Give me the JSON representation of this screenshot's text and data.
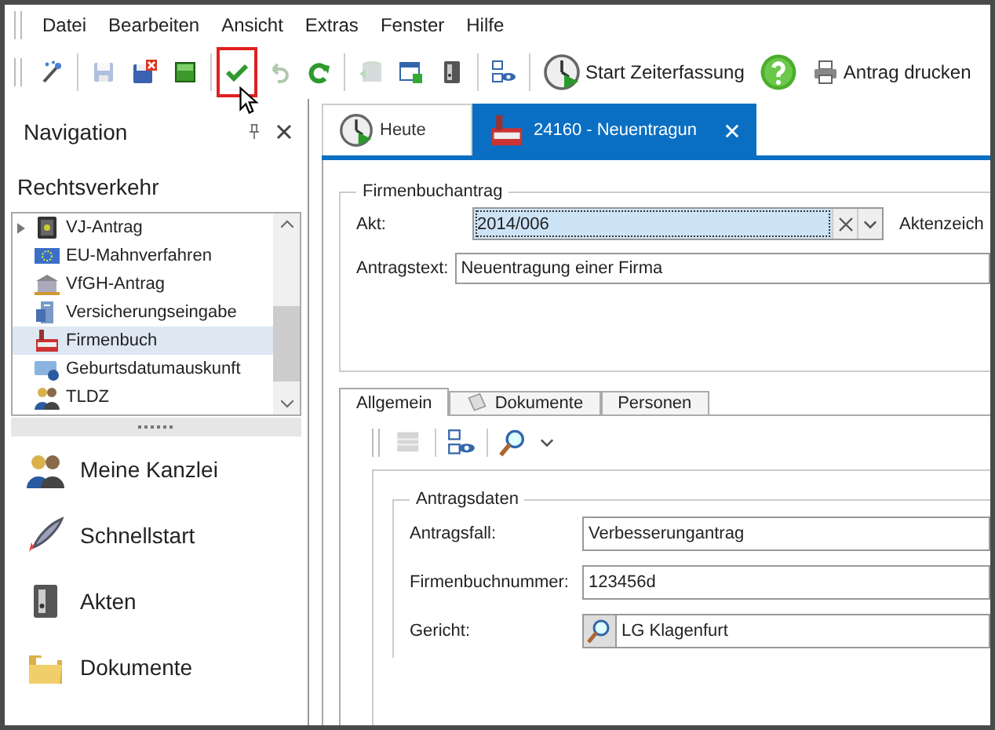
{
  "menu": [
    "Datei",
    "Bearbeiten",
    "Ansicht",
    "Extras",
    "Fenster",
    "Hilfe"
  ],
  "toolbar": [
    {
      "kind": "wand",
      "disabled": false,
      "highlighted": false
    },
    {
      "kind": "separator"
    },
    {
      "kind": "save",
      "disabled": true,
      "highlighted": false
    },
    {
      "kind": "save-close",
      "disabled": false,
      "highlighted": false
    },
    {
      "kind": "square",
      "disabled": false,
      "highlighted": false
    },
    {
      "kind": "separator"
    },
    {
      "kind": "check",
      "disabled": false,
      "highlighted": true
    },
    {
      "kind": "undo",
      "disabled": true,
      "highlighted": false
    },
    {
      "kind": "redo",
      "disabled": false,
      "highlighted": false
    },
    {
      "kind": "separator"
    },
    {
      "kind": "database",
      "disabled": true,
      "highlighted": false
    },
    {
      "kind": "form",
      "disabled": false,
      "highlighted": false
    },
    {
      "kind": "binder",
      "disabled": false,
      "highlighted": false
    },
    {
      "kind": "separator"
    },
    {
      "kind": "network",
      "disabled": false,
      "highlighted": false
    },
    {
      "kind": "separator"
    },
    {
      "kind": "clock",
      "label": "Start Zeiterfassung",
      "disabled": false,
      "highlighted": false
    },
    {
      "kind": "help",
      "disabled": false,
      "highlighted": false
    },
    {
      "kind": "printer",
      "label": "Antrag drucken",
      "disabled": false,
      "highlighted": false
    }
  ],
  "navigation": {
    "title": "Navigation",
    "section": "Rechtsverkehr",
    "items": [
      {
        "label": "VJ-Antrag",
        "expandable": true,
        "selected": false
      },
      {
        "label": "EU-Mahnverfahren",
        "expandable": false,
        "selected": false
      },
      {
        "label": "VfGH-Antrag",
        "expandable": false,
        "selected": false
      },
      {
        "label": "Versicherungseingabe",
        "expandable": false,
        "selected": false
      },
      {
        "label": "Firmenbuch",
        "expandable": false,
        "selected": true
      },
      {
        "label": "Geburtsdatumauskunft",
        "expandable": false,
        "selected": false
      },
      {
        "label": "TLDZ",
        "expandable": false,
        "selected": false
      }
    ],
    "buttons": [
      {
        "label": "Meine Kanzlei"
      },
      {
        "label": "Schnellstart"
      },
      {
        "label": "Akten"
      },
      {
        "label": "Dokumente"
      }
    ]
  },
  "document_tabs": [
    {
      "label": "Heute",
      "selected": false,
      "closable": false
    },
    {
      "label": "24160 - Neuentragun",
      "selected": true,
      "closable": true
    }
  ],
  "firmenbuchantrag": {
    "title": "Firmenbuchantrag",
    "akt_label": "Akt:",
    "akt_value": "2014/006",
    "akt_focused": true,
    "aktenzeichen_label": "Aktenzeich",
    "antragstext_label": "Antragstext:",
    "antragstext_value": "Neuentragung einer Firma"
  },
  "detail_tabs": [
    {
      "label": "Allgemein",
      "selected": true
    },
    {
      "label": "Dokumente",
      "selected": false
    },
    {
      "label": "Personen",
      "selected": false
    }
  ],
  "detail_toolbar": [
    {
      "kind": "grid",
      "disabled": true
    },
    {
      "kind": "network",
      "disabled": false
    },
    {
      "kind": "search",
      "disabled": false,
      "dropdown": true
    }
  ],
  "antragsdaten": {
    "title": "Antragsdaten",
    "fields": [
      {
        "label": "Antragsfall:",
        "value": "Verbesserungantrag",
        "lookup": false
      },
      {
        "label": "Firmenbuchnummer:",
        "value": "123456d",
        "lookup": false
      },
      {
        "label": "Gericht:",
        "value": "LG Klagenfurt",
        "lookup": true
      }
    ]
  }
}
